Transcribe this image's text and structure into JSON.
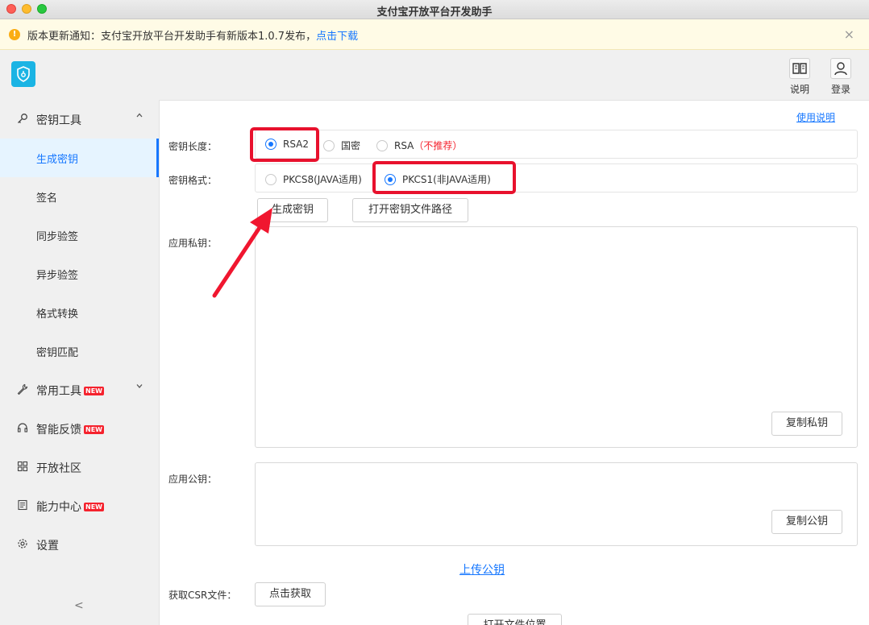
{
  "window": {
    "title": "支付宝开放平台开发助手"
  },
  "notice": {
    "icon": "warning-icon",
    "text": "版本更新通知：支付宝开放平台开发助手有新版本1.0.7发布，",
    "link": "点击下载",
    "close": "×"
  },
  "header": {
    "help_label": "说明",
    "login_label": "登录"
  },
  "sidebar": {
    "key_tools": {
      "label": "密钥工具",
      "items": [
        "生成密钥",
        "签名",
        "同步验签",
        "异步验签",
        "格式转换",
        "密钥匹配"
      ],
      "active": "生成密钥"
    },
    "common_tools": {
      "label": "常用工具",
      "badge": "NEW"
    },
    "feedback": {
      "label": "智能反馈",
      "badge": "NEW"
    },
    "community": {
      "label": "开放社区"
    },
    "capability": {
      "label": "能力中心",
      "badge": "NEW"
    },
    "settings": {
      "label": "设置"
    },
    "collapse": "<"
  },
  "main": {
    "help_link": "使用说明",
    "key_length": {
      "label": "密钥长度：",
      "options": [
        "RSA2",
        "国密",
        "RSA"
      ],
      "rsa_note": "（不推荐）",
      "selected": "RSA2"
    },
    "key_format": {
      "label": "密钥格式：",
      "options": [
        "PKCS8(JAVA适用)",
        "PKCS1(非JAVA适用)"
      ],
      "selected": "PKCS1(非JAVA适用)"
    },
    "generate_button": "生成密钥",
    "open_path_button": "打开密钥文件路径",
    "private_key": {
      "label": "应用私钥：",
      "value": "",
      "copy_button": "复制私钥"
    },
    "public_key": {
      "label": "应用公钥：",
      "value": "",
      "copy_button": "复制公钥"
    },
    "upload_link": "上传公钥",
    "csr": {
      "label": "获取CSR文件：",
      "button": "点击获取"
    },
    "open_file_button": "打开文件位置"
  },
  "colors": {
    "accent": "#1677ff",
    "highlight": "#e8112d",
    "warning": "#f5222d",
    "notice_bg": "#fffbe6"
  }
}
